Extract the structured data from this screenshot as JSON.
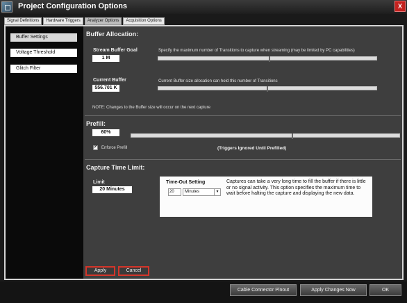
{
  "window": {
    "title": "Project Configuration Options",
    "close_label": "X"
  },
  "tabs": [
    {
      "label": "Signal Definitions"
    },
    {
      "label": "Hardware Triggers"
    },
    {
      "label": "Analyzer Options"
    },
    {
      "label": "Acquisition Options"
    }
  ],
  "active_tab": "Analyzer Options",
  "sidebar": {
    "items": [
      {
        "label": "Buffer Settings"
      },
      {
        "label": "Voltage Threshold"
      },
      {
        "label": "Glitch Filter"
      }
    ],
    "active": "Buffer Settings"
  },
  "buffer": {
    "title": "Buffer Allocation:",
    "stream_label": "Stream Buffer Goal",
    "stream_value": "1 M",
    "stream_desc": "Specify the maximum number of Transitions to capture when streaming (may be limited by PC capabilities)",
    "stream_slider_fraction": 0.51,
    "current_label": "Current Buffer",
    "current_value": "556.701 K",
    "current_desc": "Current Buffer size allocation can hold this number of Transitions",
    "current_slider_fraction": 0.5,
    "note": "NOTE: Changes to the Buffer size will occur on the next capture"
  },
  "prefill": {
    "title": "Prefill:",
    "value": "60%",
    "slider_fraction": 0.6,
    "enforce_label": "Enforce Prefill",
    "enforce_checked": "✔",
    "trigger_note": "(Triggers Ignored Until Prefilled)"
  },
  "capture": {
    "title": "Capture Time Limit:",
    "limit_label": "Limit",
    "limit_value": "20 Minutes",
    "timeout_label": "Time-Out Setting",
    "timeout_number": "20",
    "timeout_unit": "Minutes",
    "timeout_desc": "Captures can take a very long time to fill the buffer if there is little or no signal activity. This option specifies the maximum time to wait before halting the capture and displaying the new data."
  },
  "actions": {
    "apply": "Apply",
    "cancel": "Cancel"
  },
  "footer": {
    "cable_pinout": "Cable Connector Pinout",
    "apply_now": "Apply Changes Now",
    "ok": "OK"
  },
  "colors": {
    "accent_red": "#d5352a",
    "panel_dark": "#3e3e3e"
  }
}
